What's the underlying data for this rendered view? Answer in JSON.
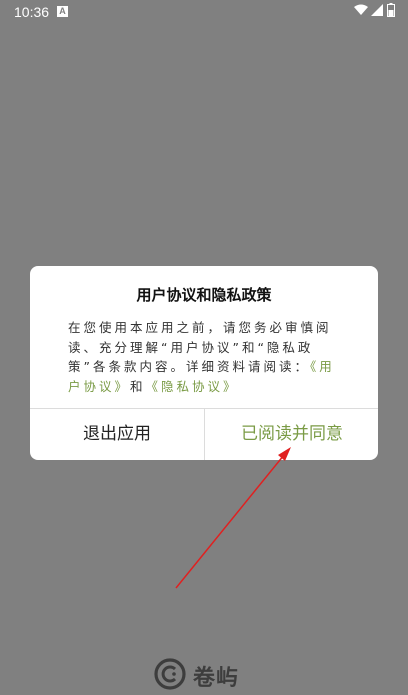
{
  "status_bar": {
    "time": "10:36",
    "notification_badge": "A",
    "icons": [
      "wifi-icon",
      "signal-icon",
      "battery-icon"
    ]
  },
  "dialog": {
    "title": "用户协议和隐私政策",
    "body_prefix": "在您使用本应用之前，请您务必审慎阅读、充分理解“用户协议”和“隐私政策”各条款内容。详细资料请阅读：",
    "link_user_agreement": "《用户协议》",
    "connector": "和",
    "link_privacy_policy": "《隐私协议》",
    "exit_button": "退出应用",
    "agree_button": "已阅读并同意"
  },
  "footer": {
    "logo_text": "卷屿",
    "logo_icon": "app-logo-icon"
  },
  "colors": {
    "overlay": "#808080",
    "accent": "#7a9b45",
    "annotation_arrow": "#e02020"
  }
}
